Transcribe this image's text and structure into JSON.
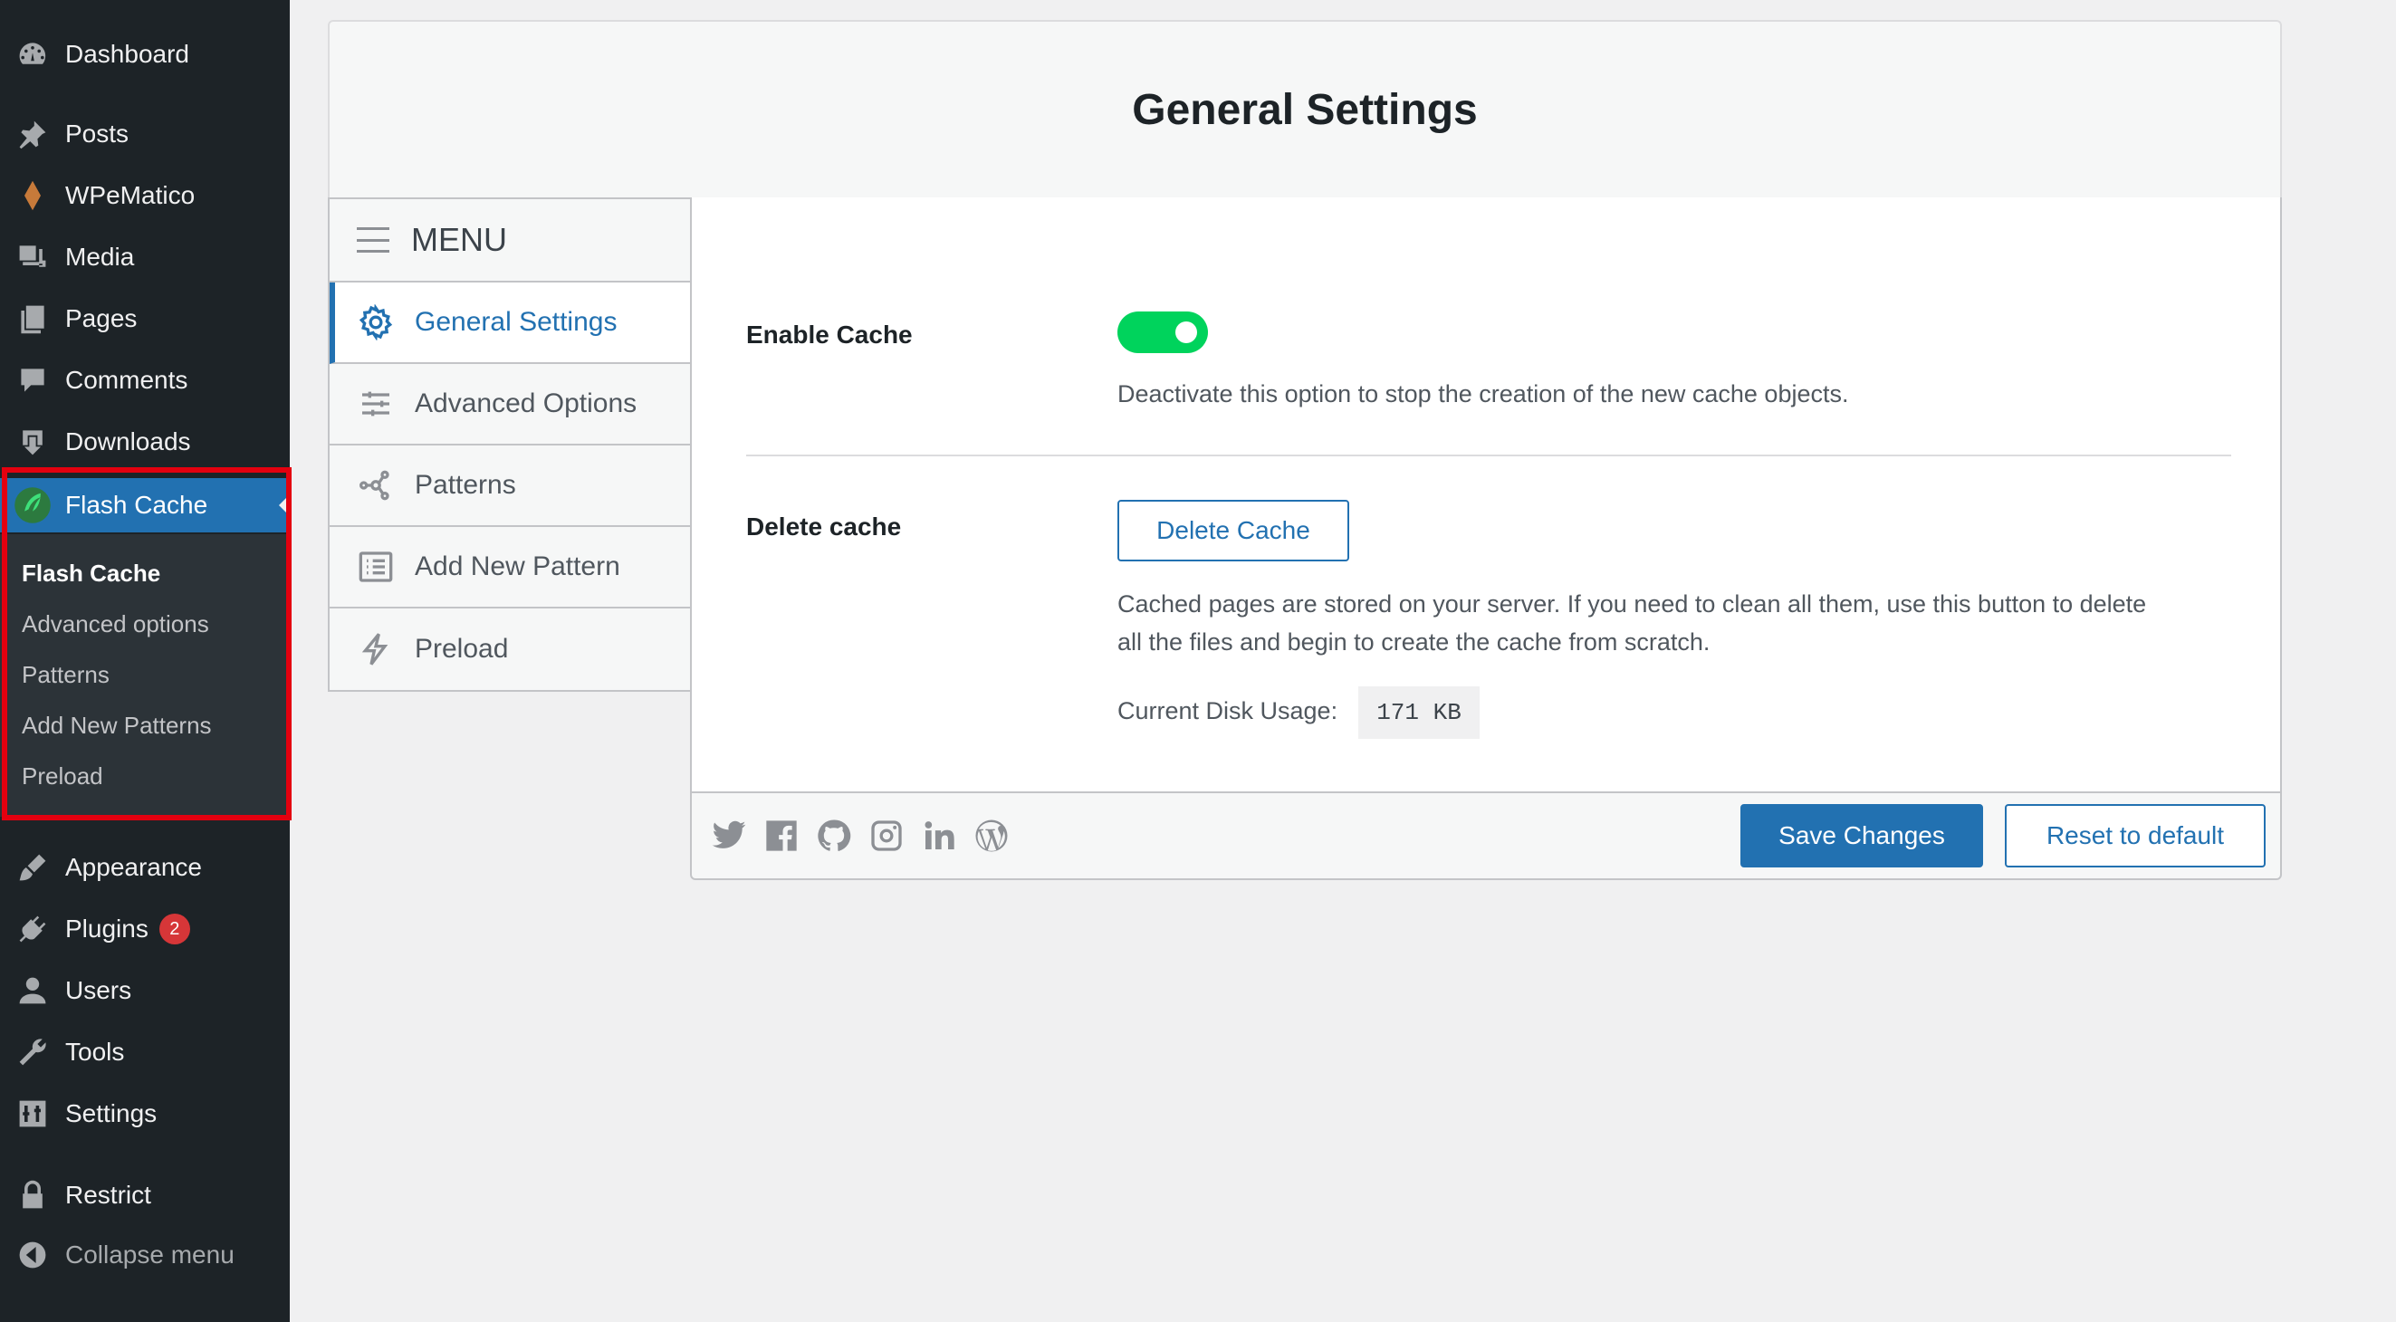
{
  "sidebar": {
    "items": [
      {
        "label": "Dashboard",
        "icon": "dashboard-icon"
      },
      {
        "label": "Posts",
        "icon": "pushpin-icon"
      },
      {
        "label": "WPeMatico",
        "icon": "wpematico-icon"
      },
      {
        "label": "Media",
        "icon": "media-icon"
      },
      {
        "label": "Pages",
        "icon": "pages-icon"
      },
      {
        "label": "Comments",
        "icon": "comment-icon"
      },
      {
        "label": "Downloads",
        "icon": "download-icon"
      },
      {
        "label": "Flash Cache",
        "icon": "flash-cache-logo-icon"
      },
      {
        "label": "Appearance",
        "icon": "paintbrush-icon"
      },
      {
        "label": "Plugins",
        "icon": "plug-icon",
        "badge": "2"
      },
      {
        "label": "Users",
        "icon": "user-icon"
      },
      {
        "label": "Tools",
        "icon": "wrench-icon"
      },
      {
        "label": "Settings",
        "icon": "settings-sliders-icon"
      },
      {
        "label": "Restrict",
        "icon": "lock-icon"
      },
      {
        "label": "Collapse menu",
        "icon": "collapse-icon"
      }
    ],
    "submenu": [
      "Flash Cache",
      "Advanced options",
      "Patterns",
      "Add New Patterns",
      "Preload"
    ],
    "active_color": "#2271b1",
    "highlight_color": "#e4000f"
  },
  "panel": {
    "title": "General Settings",
    "menu_title": "MENU",
    "menu_items": [
      {
        "label": "General Settings",
        "icon": "gear-icon"
      },
      {
        "label": "Advanced Options",
        "icon": "sliders-icon"
      },
      {
        "label": "Patterns",
        "icon": "network-icon"
      },
      {
        "label": "Add New Pattern",
        "icon": "list-icon"
      },
      {
        "label": "Preload",
        "icon": "lightning-icon"
      }
    ],
    "enable_cache": {
      "label": "Enable Cache",
      "enabled": true,
      "description": "Deactivate this option to stop the creation of the new cache objects."
    },
    "delete_cache": {
      "label": "Delete cache",
      "button": "Delete Cache",
      "description_line1": "Cached pages are stored on your server. If you need to clean all them, use this button to delete",
      "description_line2": "all the files and begin to create the cache from scratch.",
      "disk_label": "Current Disk Usage:",
      "disk_value": "171 KB"
    },
    "footer": {
      "social_icons": [
        "twitter-icon",
        "facebook-icon",
        "github-icon",
        "instagram-icon",
        "linkedin-icon",
        "wordpress-icon"
      ],
      "save_label": "Save Changes",
      "reset_label": "Reset to default"
    },
    "toggle_color": "#00d35c"
  }
}
